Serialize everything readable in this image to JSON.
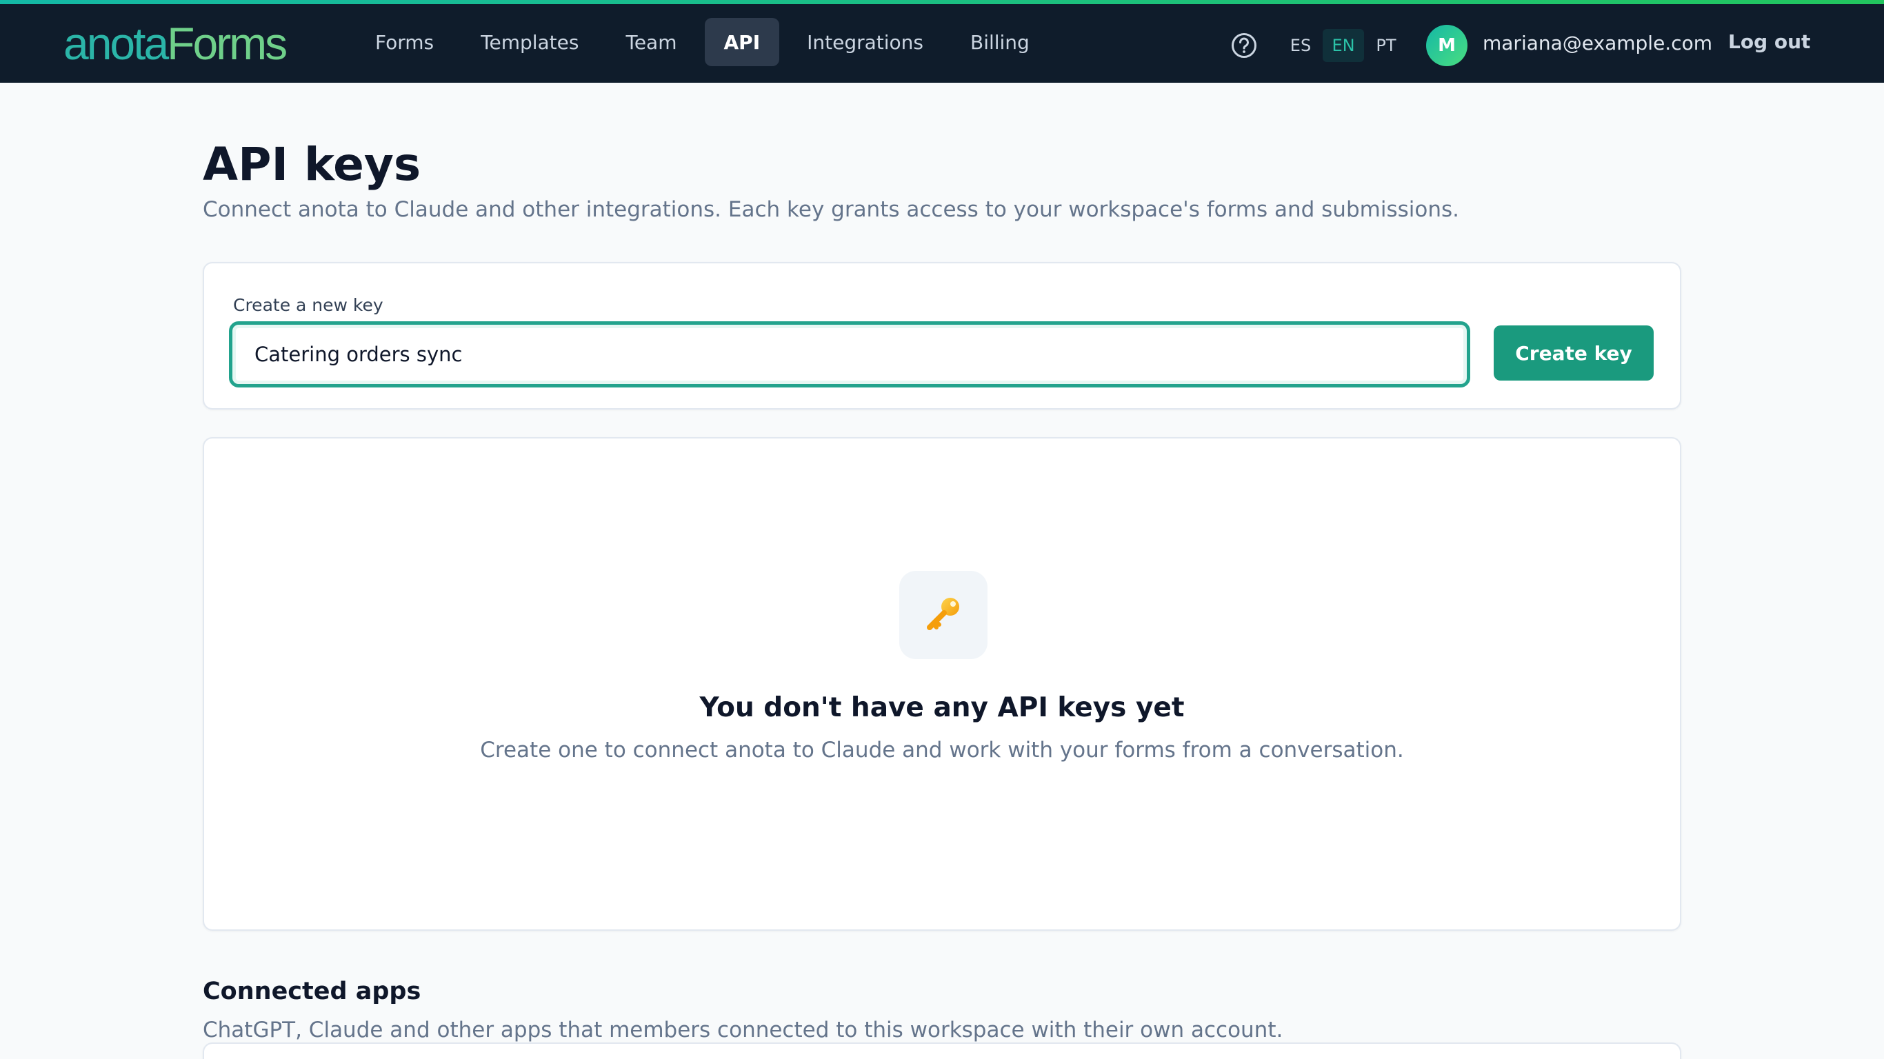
{
  "brand": {
    "part1": "anota",
    "part2": "Forms"
  },
  "nav": {
    "items": [
      {
        "label": "Forms",
        "active": false
      },
      {
        "label": "Templates",
        "active": false
      },
      {
        "label": "Team",
        "active": false
      },
      {
        "label": "API",
        "active": true
      },
      {
        "label": "Integrations",
        "active": false
      },
      {
        "label": "Billing",
        "active": false
      }
    ]
  },
  "header": {
    "help_icon": "question-circle-icon",
    "languages": [
      {
        "code": "ES",
        "selected": false
      },
      {
        "code": "EN",
        "selected": true
      },
      {
        "code": "PT",
        "selected": false
      }
    ],
    "avatar_initial": "M",
    "email": "mariana@example.com",
    "logout_label": "Log out"
  },
  "page": {
    "title": "API keys",
    "subtitle": "Connect anota to Claude and other integrations. Each key grants access to your workspace's forms and submissions."
  },
  "create_key": {
    "label": "Create a new key",
    "input_value": "Catering orders sync",
    "button_label": "Create key"
  },
  "empty_state": {
    "icon": "key-icon",
    "title": "You don't have any API keys yet",
    "description": "Create one to connect anota to Claude and work with your forms from a conversation."
  },
  "connected_apps": {
    "title": "Connected apps",
    "description": "ChatGPT, Claude and other apps that members connected to this workspace with their own account."
  },
  "colors": {
    "topbar": "#0f1c2b",
    "accent": "#1a9a7e",
    "brand_teal": "#2bb5a8",
    "brand_green": "#6fd08a"
  }
}
